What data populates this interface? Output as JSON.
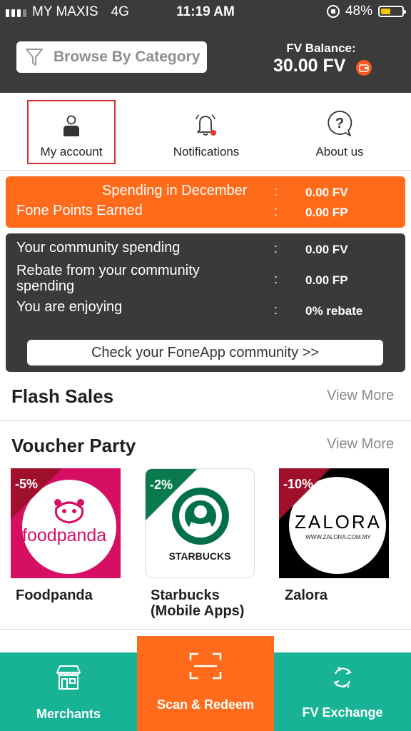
{
  "status_bar": {
    "carrier": "MY MAXIS",
    "network": "4G",
    "time": "11:19 AM",
    "battery_percent": "48%",
    "battery_level": 0.48
  },
  "header": {
    "search_placeholder": "Browse By Category",
    "balance_label": "FV Balance:",
    "balance_value": "30.00 FV",
    "background": "#3b3b3b"
  },
  "quick_nav": [
    {
      "label": "My account",
      "icon": "user-icon",
      "selected": true
    },
    {
      "label": "Notifications",
      "icon": "bell-icon",
      "has_badge": true
    },
    {
      "label": "About us",
      "icon": "question-icon"
    }
  ],
  "spending_card": {
    "color": "#ff6b1a",
    "rows": [
      {
        "label": "Spending in December",
        "value": "0.00 FV"
      },
      {
        "label": "Fone Points Earned",
        "value": "0.00 FP"
      }
    ]
  },
  "community_card": {
    "rows": [
      {
        "label": "Your community spending",
        "value": "0.00 FV"
      },
      {
        "label": "Rebate from your community spending",
        "value": "0.00 FP"
      },
      {
        "label": "You are enjoying",
        "value": "0% rebate"
      }
    ],
    "button_label": "Check your FoneApp community >>"
  },
  "flash_sales": {
    "title": "Flash Sales",
    "view_more": "View More"
  },
  "voucher_party": {
    "title": "Voucher Party",
    "view_more": "View More",
    "vouchers": [
      {
        "name": "Foodpanda",
        "discount": "-5%",
        "brand_text": "foodpanda",
        "color": "#d70f64",
        "corner": "#a0102c"
      },
      {
        "name": "Starbucks (Mobile Apps)",
        "discount": "-2%",
        "brand_text": "STARBUCKS",
        "color": "#00704a",
        "corner": "#0a7a4e"
      },
      {
        "name": "Zalora",
        "discount": "-10%",
        "brand_text": "ZALORA",
        "brand_sub": "WWW.ZALORA.COM.MY",
        "color": "#000000",
        "corner": "#a0102c"
      }
    ]
  },
  "bottom_nav": {
    "merchants": "Merchants",
    "scan": "Scan & Redeem",
    "exchange": "FV Exchange",
    "teal": "#17b394",
    "orange": "#ff6b1a"
  }
}
